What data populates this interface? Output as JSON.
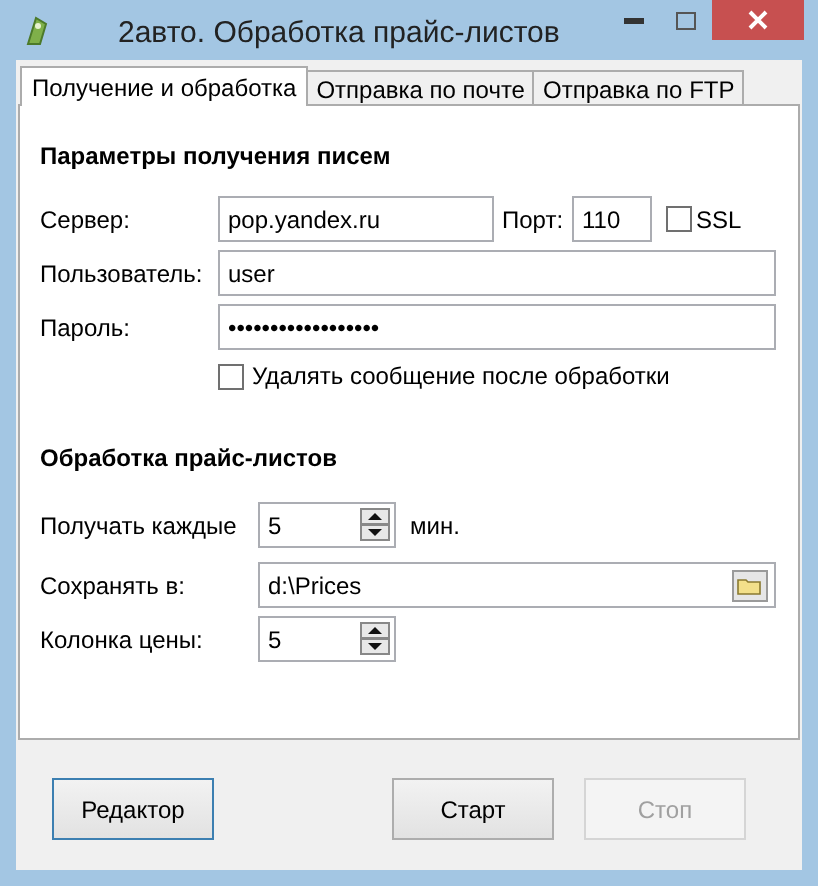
{
  "window": {
    "title": "2авто. Обработка прайс-листов"
  },
  "tabs": [
    {
      "label": "Получение и обработка",
      "selected": true
    },
    {
      "label": "Отправка по почте",
      "selected": false
    },
    {
      "label": "Отправка по FTP",
      "selected": false
    }
  ],
  "mail": {
    "heading": "Параметры получения писем",
    "server": {
      "label": "Сервер:",
      "value": "pop.yandex.ru"
    },
    "port": {
      "label": "Порт:",
      "value": "110"
    },
    "ssl": {
      "label": "SSL",
      "checked": false
    },
    "user": {
      "label": "Пользователь:",
      "value": "user"
    },
    "password": {
      "label": "Пароль:",
      "value": "••••••••••••••••••"
    },
    "delete_after": {
      "label": "Удалять сообщение после обработки",
      "checked": false
    }
  },
  "processing": {
    "heading": "Обработка прайс-листов",
    "interval": {
      "label": "Получать каждые",
      "value": "5",
      "unit": "мин."
    },
    "save_to": {
      "label": "Сохранять в:",
      "value": "d:\\Prices"
    },
    "price_column": {
      "label": "Колонка цены:",
      "value": "5"
    }
  },
  "buttons": [
    {
      "label": "Редактор",
      "disabled": false,
      "focused": true
    },
    {
      "label": "Старт",
      "disabled": false,
      "focused": false
    },
    {
      "label": "Стоп",
      "disabled": true,
      "focused": false
    }
  ]
}
